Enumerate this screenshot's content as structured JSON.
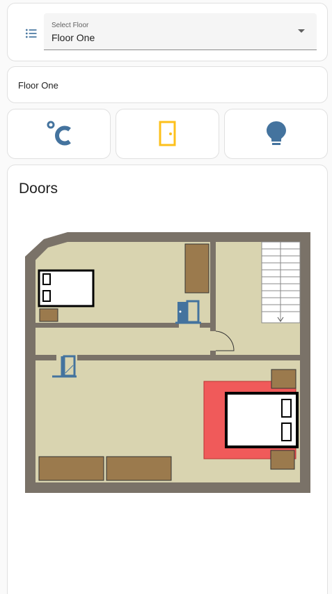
{
  "floor_select": {
    "label": "Select Floor",
    "value": "Floor One",
    "icon": "format-list-bulleted-icon"
  },
  "floor_name": "Floor One",
  "mode_buttons": [
    {
      "id": "temperature",
      "icon": "celsius-icon",
      "color": "#44739e"
    },
    {
      "id": "doors",
      "icon": "door-icon",
      "color": "#fdc01b",
      "active": true
    },
    {
      "id": "lights",
      "icon": "lightbulb-icon",
      "color": "#44739e"
    }
  ],
  "plan": {
    "title": "Doors",
    "colors": {
      "wall": "#7a7268",
      "floor": "#d9d4b0",
      "furniture": "#9b7a4d",
      "rug": "#f05a5a",
      "door_icon": "#44739e"
    }
  }
}
